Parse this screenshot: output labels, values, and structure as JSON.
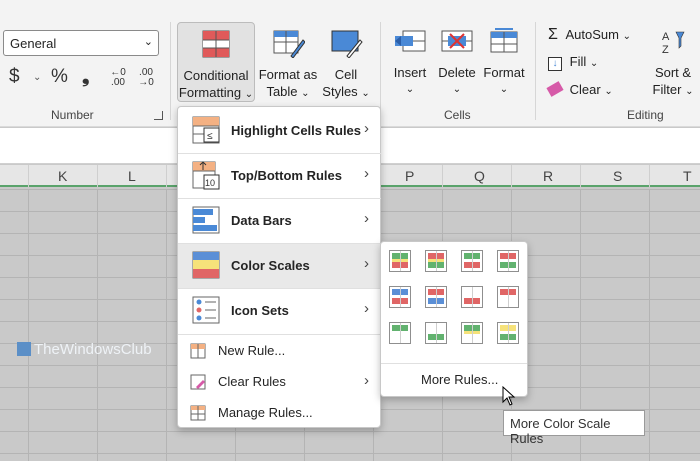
{
  "number_group": {
    "format_value": "General",
    "currency_symbol": "$",
    "percent_symbol": "%",
    "comma_symbol": "❟",
    "increase_decimal": "←0 .00",
    "decrease_decimal": ".00 →0",
    "label": "Number"
  },
  "styles_group": {
    "conditional_formatting_line1": "Conditional",
    "conditional_formatting_line2": "Formatting",
    "format_as_table_line1": "Format as",
    "format_as_table_line2": "Table",
    "cell_styles_line1": "Cell",
    "cell_styles_line2": "Styles"
  },
  "cells_group": {
    "insert_label": "Insert",
    "delete_label": "Delete",
    "format_label": "Format",
    "label": "Cells"
  },
  "editing_group": {
    "autosum_label": "AutoSum",
    "fill_label": "Fill",
    "clear_label": "Clear",
    "sort_filter_line1": "Sort &",
    "sort_filter_line2": "Filter",
    "label": "Editing"
  },
  "columns": [
    "K",
    "L",
    "P",
    "Q",
    "R",
    "S",
    "T"
  ],
  "cf_menu": {
    "items": [
      {
        "label": "Highlight Cells Rules",
        "icon": "highlight-cells-icon"
      },
      {
        "label": "Top/Bottom Rules",
        "icon": "top-bottom-icon"
      },
      {
        "label": "Data Bars",
        "icon": "data-bars-icon"
      },
      {
        "label": "Color Scales",
        "icon": "color-scales-icon"
      },
      {
        "label": "Icon Sets",
        "icon": "icon-sets-icon"
      }
    ],
    "new_rule": "New Rule...",
    "clear_rules": "Clear Rules",
    "manage_rules": "Manage Rules..."
  },
  "color_scales_submenu": {
    "more_rules": "More Rules..."
  },
  "tooltip": "More Color Scale Rules",
  "watermark": "TheWindowsClub",
  "colors": {
    "accent_green": "#5aa36b",
    "scale_red": "#e06666",
    "scale_yellow": "#f6e27a",
    "scale_green": "#62b26f",
    "scale_blue": "#5b8fd6"
  }
}
